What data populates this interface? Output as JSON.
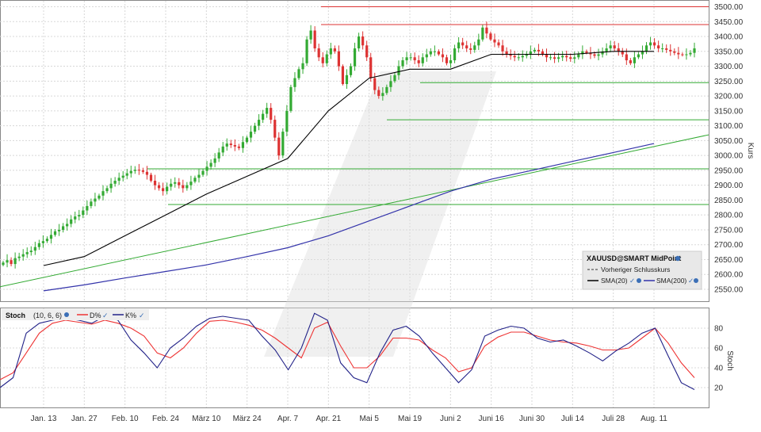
{
  "chart_data": [
    {
      "type": "candlestick",
      "panel": "price",
      "instrument_label": "XAUUSD@SMART MidPoint",
      "ylabel": "Kurs",
      "ylim": [
        2510,
        3520
      ],
      "y_ticks": [
        2550,
        2600,
        2650,
        2700,
        2750,
        2800,
        2850,
        2900,
        2950,
        3000,
        3050,
        3100,
        3150,
        3200,
        3250,
        3300,
        3350,
        3400,
        3450,
        3500
      ],
      "y_tick_labels": [
        "2550.00",
        "2600.00",
        "2650.00",
        "2700.00",
        "2750.00",
        "2800.00",
        "2850.00",
        "2900.00",
        "2950.00",
        "3000.00",
        "3050.00",
        "3100.00",
        "3150.00",
        "3200.00",
        "3250.00",
        "3300.00",
        "3350.00",
        "3400.00",
        "3450.00",
        "3500.00"
      ],
      "x_tick_labels": [
        "Jan. 13",
        "Jan. 27",
        "Feb. 10",
        "Feb. 24",
        "März 10",
        "März 24",
        "Apr. 7",
        "Apr. 21",
        "Mai 5",
        "Mai 19",
        "Juni 2",
        "Juni 16",
        "Juni 30",
        "Juli 14",
        "Juli 28",
        "Aug. 11"
      ],
      "close_series": [
        2640,
        2648,
        2635,
        2655,
        2660,
        2668,
        2675,
        2680,
        2692,
        2705,
        2712,
        2720,
        2733,
        2745,
        2750,
        2762,
        2770,
        2785,
        2795,
        2800,
        2815,
        2830,
        2845,
        2855,
        2865,
        2880,
        2890,
        2905,
        2915,
        2925,
        2932,
        2940,
        2948,
        2952,
        2950,
        2945,
        2935,
        2915,
        2900,
        2890,
        2880,
        2895,
        2905,
        2910,
        2900,
        2890,
        2900,
        2912,
        2925,
        2935,
        2948,
        2962,
        2975,
        2990,
        3010,
        3030,
        3040,
        3035,
        3030,
        3025,
        3045,
        3060,
        3080,
        3100,
        3120,
        3140,
        3160,
        3120,
        3060,
        3000,
        3080,
        3150,
        3230,
        3260,
        3290,
        3310,
        3390,
        3420,
        3360,
        3330,
        3310,
        3340,
        3360,
        3350,
        3300,
        3240,
        3270,
        3300,
        3360,
        3400,
        3370,
        3330,
        3260,
        3220,
        3200,
        3210,
        3230,
        3250,
        3270,
        3300,
        3320,
        3330,
        3330,
        3320,
        3310,
        3330,
        3340,
        3350,
        3350,
        3340,
        3330,
        3310,
        3320,
        3360,
        3380,
        3370,
        3360,
        3355,
        3370,
        3390,
        3430,
        3410,
        3390,
        3380,
        3370,
        3350,
        3340,
        3335,
        3330,
        3330,
        3335,
        3340,
        3350,
        3355,
        3350,
        3340,
        3330,
        3330,
        3325,
        3330,
        3335,
        3330,
        3325,
        3330,
        3340,
        3350,
        3345,
        3340,
        3335,
        3340,
        3350,
        3360,
        3370,
        3360,
        3350,
        3340,
        3320,
        3310,
        3330,
        3340,
        3350,
        3370,
        3380,
        3370,
        3360,
        3360,
        3355,
        3350,
        3345,
        3340,
        3338,
        3340,
        3345,
        3360
      ],
      "sma20": {
        "label": "SMA(20)",
        "color": "#000000",
        "x": [
          "Jan. 13",
          "Jan. 27",
          "Feb. 10",
          "Feb. 24",
          "März 10",
          "März 24",
          "Apr. 7",
          "Apr. 21",
          "Mai 5",
          "Mai 19",
          "Juni 2",
          "Juni 16",
          "Juni 30",
          "Juli 14",
          "Juli 28",
          "Aug. 11"
        ],
        "y": [
          2630,
          2660,
          2730,
          2800,
          2870,
          2930,
          2990,
          3150,
          3260,
          3290,
          3290,
          3340,
          3340,
          3340,
          3350,
          3350
        ]
      },
      "sma200": {
        "label": "SMA(200)",
        "color": "#3333aa",
        "x": [
          "Jan. 13",
          "Jan. 27",
          "Feb. 10",
          "Feb. 24",
          "März 10",
          "März 24",
          "Apr. 7",
          "Apr. 21",
          "Mai 5",
          "Mai 19",
          "Juni 2",
          "Juni 16",
          "Juni 30",
          "Juli 14",
          "Juli 28",
          "Aug. 11"
        ],
        "y": [
          2545,
          2565,
          2588,
          2610,
          2632,
          2660,
          2690,
          2730,
          2780,
          2830,
          2880,
          2920,
          2950,
          2980,
          3010,
          3040
        ]
      },
      "legend": {
        "title": "XAUUSD@SMART MidPoint",
        "prev_close_label": "Vorheriger Schlusskurs",
        "sma20_label": "SMA(20)",
        "sma200_label": "SMA(200)"
      },
      "horizontal_levels": [
        {
          "value": 3500,
          "color": "#dd3333"
        },
        {
          "value": 3440,
          "color": "#dd3333"
        },
        {
          "value": 3245,
          "color": "#33aa33"
        },
        {
          "value": 3120,
          "color": "#33aa33"
        },
        {
          "value": 2955,
          "color": "#33aa33"
        },
        {
          "value": 2835,
          "color": "#33aa33"
        }
      ],
      "trendline": {
        "color": "#33aa33",
        "from": {
          "x": "Jan. 13",
          "y": 2590
        },
        "to": {
          "x": "Aug. 11",
          "y": 3030
        }
      },
      "colors": {
        "up": "#33aa33",
        "down": "#dd3333",
        "grid": "#d8d8d8"
      }
    },
    {
      "type": "line",
      "panel": "stochastic",
      "title": "Stoch",
      "params": "(10, 6, 6)",
      "ylabel": "Stoch",
      "ylim": [
        0,
        100
      ],
      "y_ticks": [
        20,
        40,
        60,
        80
      ],
      "series": [
        {
          "name": "D%",
          "color": "#ee3333",
          "values": [
            28,
            35,
            55,
            75,
            85,
            88,
            86,
            84,
            88,
            85,
            80,
            72,
            55,
            50,
            60,
            75,
            87,
            88,
            86,
            83,
            78,
            70,
            60,
            50,
            80,
            86,
            62,
            40,
            40,
            52,
            70,
            70,
            68,
            58,
            50,
            36,
            40,
            62,
            71,
            76,
            76,
            72,
            68,
            66,
            65,
            62,
            58,
            58,
            60,
            70,
            80,
            65,
            45,
            30
          ]
        },
        {
          "name": "K%",
          "color": "#222288",
          "values": [
            20,
            30,
            75,
            85,
            88,
            90,
            88,
            85,
            92,
            88,
            68,
            55,
            40,
            60,
            70,
            82,
            90,
            92,
            90,
            88,
            72,
            58,
            38,
            60,
            95,
            88,
            45,
            30,
            25,
            55,
            78,
            82,
            72,
            55,
            40,
            25,
            38,
            72,
            78,
            82,
            80,
            70,
            66,
            68,
            62,
            55,
            47,
            57,
            65,
            75,
            80,
            52,
            25,
            18
          ]
        }
      ]
    }
  ]
}
